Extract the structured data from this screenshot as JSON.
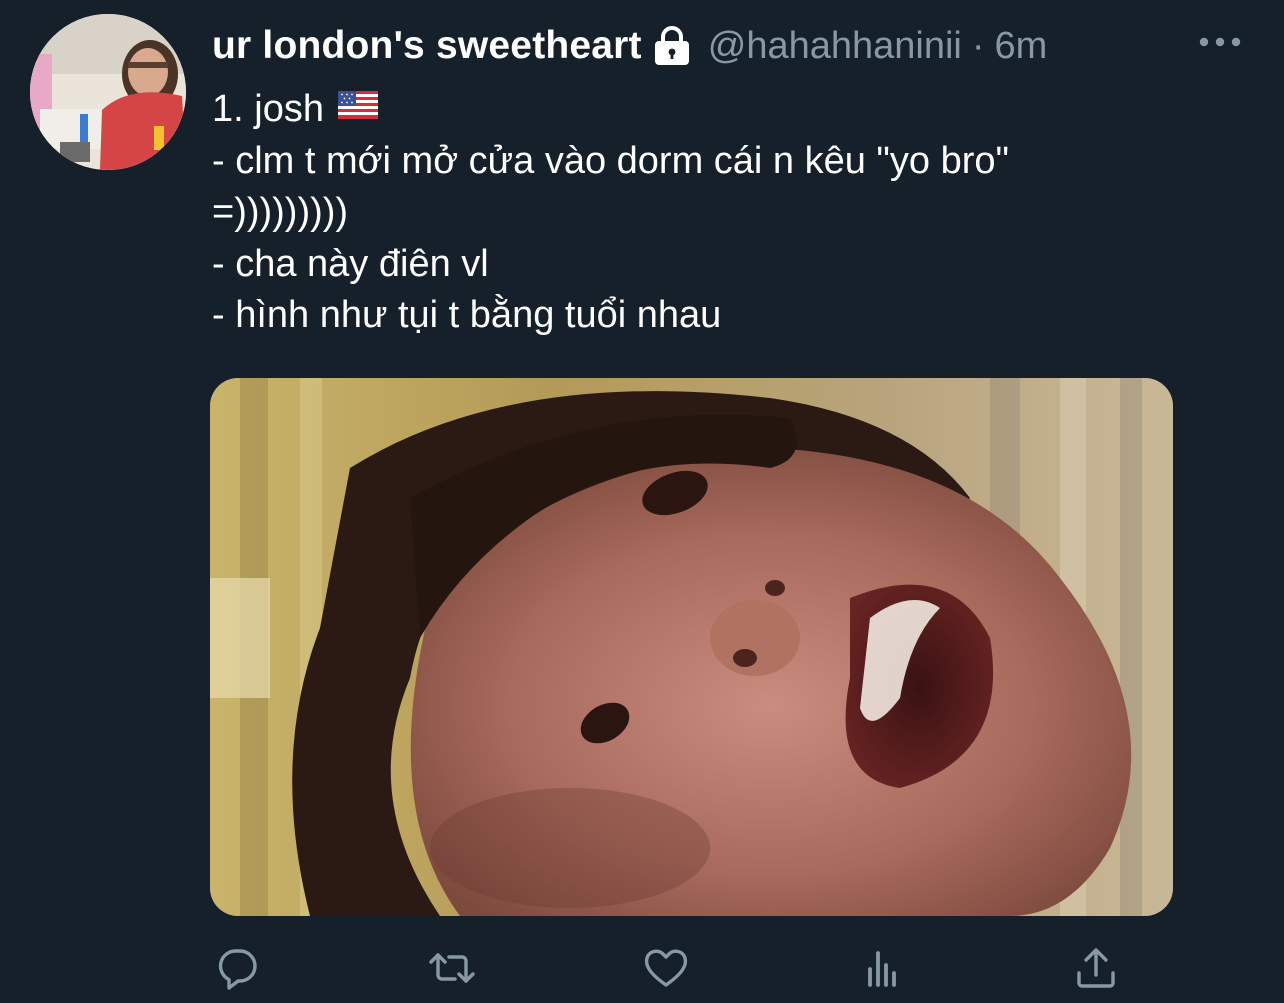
{
  "tweet": {
    "display_name": "ur london's sweetheart",
    "handle": "@hahahhaninii",
    "separator": "·",
    "time": "6m",
    "lines": [
      "1. josh",
      "- clm t mới mở cửa vào dorm cái n kêu \"yo bro\"",
      "=)))))))))",
      "- cha này điên vl",
      "- hình như tụi t bằng tuổi nhau"
    ]
  },
  "icons": {
    "lock": "lock-icon",
    "more": "more-icon",
    "flag": "us-flag-icon",
    "reply": "reply-icon",
    "retweet": "retweet-icon",
    "like": "like-icon",
    "analytics": "analytics-icon",
    "share": "share-icon"
  },
  "colors": {
    "background": "#15202b",
    "text": "#ffffff",
    "secondary": "#8899a6"
  }
}
